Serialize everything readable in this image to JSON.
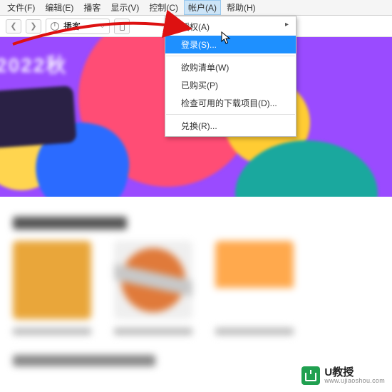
{
  "menubar": {
    "items": [
      {
        "label": "文件(F)"
      },
      {
        "label": "编辑(E)"
      },
      {
        "label": "播客"
      },
      {
        "label": "显示(V)"
      },
      {
        "label": "控制(C)"
      },
      {
        "label": "帐户(A)",
        "active": true
      },
      {
        "label": "帮助(H)"
      }
    ]
  },
  "toolbar": {
    "back_icon": "chevron-left-icon",
    "forward_icon": "chevron-right-icon",
    "picker_label": "播客",
    "picker_icon": "podcast-icon",
    "device_icon": "phone-icon"
  },
  "dropdown": {
    "items": [
      {
        "label": "授权(A)",
        "has_submenu": true
      },
      {
        "label": "登录(S)...",
        "highlighted": true
      },
      {
        "label": "欲购清单(W)"
      },
      {
        "label": "已购买(P)"
      },
      {
        "label": "检查可用的下载项目(D)..."
      },
      {
        "label": "兑换(R)..."
      }
    ]
  },
  "banner": {
    "headline": "2022秋"
  },
  "watermark": {
    "brand": "U教授",
    "url": "www.ujiaoshou.com"
  }
}
